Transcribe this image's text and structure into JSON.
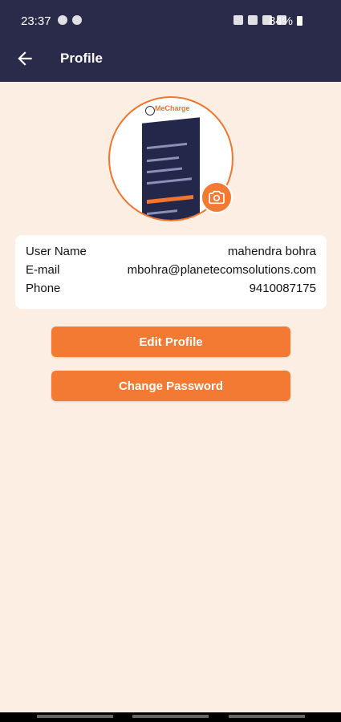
{
  "status_bar": {
    "time": "23:37",
    "battery": "84%"
  },
  "header": {
    "title": "Profile"
  },
  "avatar": {
    "logo_text": "MeCharge"
  },
  "profile": {
    "rows": [
      {
        "label": "User Name",
        "value": "mahendra bohra"
      },
      {
        "label": "E-mail",
        "value": "mbohra@planetecomsolutions.com"
      },
      {
        "label": "Phone",
        "value": "9410087175"
      }
    ]
  },
  "buttons": {
    "edit_profile": "Edit Profile",
    "change_password": "Change Password"
  },
  "colors": {
    "header_bg": "#2a2b4a",
    "accent": "#f37a33",
    "page_bg": "#fdeee4"
  }
}
